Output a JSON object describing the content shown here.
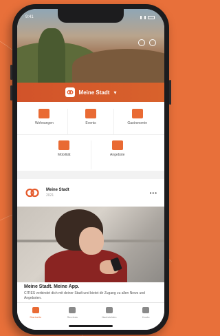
{
  "status_bar": {
    "time": "9:41"
  },
  "header": {
    "city_name": "Meine Stadt",
    "chevron": "▾"
  },
  "tiles": [
    {
      "label": "Wohnungen",
      "icon": "building-icon"
    },
    {
      "label": "Events",
      "icon": "calendar-icon"
    },
    {
      "label": "Gastronomie",
      "icon": "plate-icon"
    },
    {
      "label": "Mobilität",
      "icon": "car-icon"
    },
    {
      "label": "Angebote",
      "icon": "tag-icon"
    }
  ],
  "post": {
    "author": "Meine Stadt",
    "date": "2021",
    "more": "•••",
    "title": "Meine Stadt. Meine App.",
    "text": "CITIES verbindet dich mit deiner Stadt und bietet dir Zugang zu allen News und Angeboten."
  },
  "tab_bar": [
    {
      "label": "Startseite",
      "active": true,
      "icon": "home-icon"
    },
    {
      "label": "Services",
      "active": false,
      "icon": "grid-icon"
    },
    {
      "label": "Nachrichten",
      "active": false,
      "icon": "news-icon"
    },
    {
      "label": "Konto",
      "active": false,
      "icon": "user-icon"
    }
  ],
  "colors": {
    "accent": "#e96a33",
    "background": "#e8703a"
  }
}
